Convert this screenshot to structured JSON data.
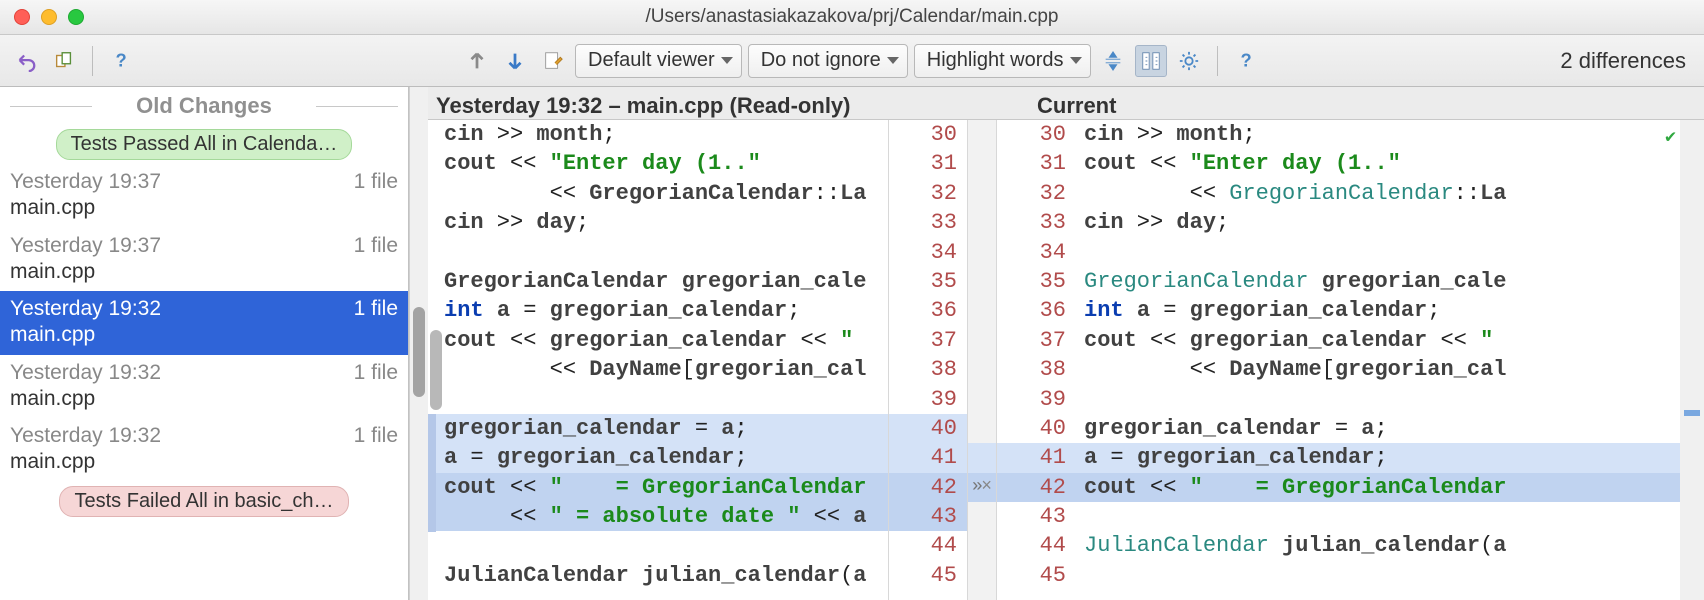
{
  "window": {
    "title": "/Users/anastasiakazakova/prj/Calendar/main.cpp"
  },
  "toolbar": {
    "viewer": "Default viewer",
    "ignore": "Do not ignore",
    "highlight": "Highlight words",
    "diff_count": "2 differences"
  },
  "sidebar": {
    "section": "Old Changes",
    "pill_pass": "Tests Passed All in Calenda…",
    "pill_fail": "Tests Failed All in basic_ch…",
    "items": [
      {
        "ts": "Yesterday 19:37",
        "fc": "1 file",
        "fn": "main.cpp"
      },
      {
        "ts": "Yesterday 19:37",
        "fc": "1 file",
        "fn": "main.cpp"
      },
      {
        "ts": "Yesterday 19:32",
        "fc": "1 file",
        "fn": "main.cpp"
      },
      {
        "ts": "Yesterday 19:32",
        "fc": "1 file",
        "fn": "main.cpp"
      },
      {
        "ts": "Yesterday 19:32",
        "fc": "1 file",
        "fn": "main.cpp"
      }
    ]
  },
  "diff": {
    "left_header": "Yesterday 19:32 – main.cpp (Read-only)",
    "right_header": "Current",
    "line_start": 30,
    "left_lines": [
      [
        [
          "id",
          "cin"
        ],
        [
          "plain",
          " >> "
        ],
        [
          "id",
          "month"
        ],
        [
          "plain",
          ";"
        ]
      ],
      [
        [
          "id",
          "cout"
        ],
        [
          "plain",
          " << "
        ],
        [
          "str",
          "\"Enter day (1..\""
        ]
      ],
      [
        [
          "plain",
          "        << "
        ],
        [
          "id",
          "GregorianCalendar"
        ],
        [
          "plain",
          "::"
        ],
        [
          "id",
          "La"
        ]
      ],
      [
        [
          "id",
          "cin"
        ],
        [
          "plain",
          " >> "
        ],
        [
          "id",
          "day"
        ],
        [
          "plain",
          ";"
        ]
      ],
      [],
      [
        [
          "id",
          "GregorianCalendar"
        ],
        [
          "plain",
          " "
        ],
        [
          "id",
          "gregorian_cale"
        ]
      ],
      [
        [
          "kw",
          "int"
        ],
        [
          "plain",
          " "
        ],
        [
          "id",
          "a"
        ],
        [
          "plain",
          " = "
        ],
        [
          "id",
          "gregorian_calendar"
        ],
        [
          "plain",
          ";"
        ]
      ],
      [
        [
          "id",
          "cout"
        ],
        [
          "plain",
          " << "
        ],
        [
          "id",
          "gregorian_calendar"
        ],
        [
          "plain",
          " << "
        ],
        [
          "str",
          "\" "
        ]
      ],
      [
        [
          "plain",
          "        << "
        ],
        [
          "id",
          "DayName"
        ],
        [
          "plain",
          "["
        ],
        [
          "id",
          "gregorian_cal"
        ]
      ],
      [],
      [
        [
          "id",
          "gregorian_calendar"
        ],
        [
          "plain",
          " = "
        ],
        [
          "id",
          "a"
        ],
        [
          "plain",
          ";"
        ]
      ],
      [
        [
          "id",
          "a"
        ],
        [
          "plain",
          " = "
        ],
        [
          "id",
          "gregorian_calendar"
        ],
        [
          "plain",
          ";"
        ]
      ],
      [
        [
          "id",
          "cout"
        ],
        [
          "plain",
          " << "
        ],
        [
          "str",
          "\"    = GregorianCalendar"
        ]
      ],
      [
        [
          "plain",
          "     << "
        ],
        [
          "str",
          "\" = absolute date \""
        ],
        [
          "plain",
          " << "
        ],
        [
          "id",
          "a"
        ]
      ],
      [],
      [
        [
          "id",
          "JulianCalendar"
        ],
        [
          "plain",
          " "
        ],
        [
          "id",
          "julian_calendar"
        ],
        [
          "plain",
          "("
        ],
        [
          "id",
          "a"
        ]
      ]
    ],
    "right_lines": [
      [
        [
          "id",
          "cin"
        ],
        [
          "plain",
          " >> "
        ],
        [
          "id",
          "month"
        ],
        [
          "plain",
          ";"
        ]
      ],
      [
        [
          "id",
          "cout"
        ],
        [
          "plain",
          " << "
        ],
        [
          "str",
          "\"Enter day (1..\""
        ]
      ],
      [
        [
          "plain",
          "        << "
        ],
        [
          "type",
          "GregorianCalendar"
        ],
        [
          "plain",
          "::"
        ],
        [
          "id",
          "La"
        ]
      ],
      [
        [
          "id",
          "cin"
        ],
        [
          "plain",
          " >> "
        ],
        [
          "id",
          "day"
        ],
        [
          "plain",
          ";"
        ]
      ],
      [],
      [
        [
          "type",
          "GregorianCalendar"
        ],
        [
          "plain",
          " "
        ],
        [
          "id",
          "gregorian_cale"
        ]
      ],
      [
        [
          "kw",
          "int"
        ],
        [
          "plain",
          " "
        ],
        [
          "id",
          "a"
        ],
        [
          "plain",
          " = "
        ],
        [
          "id",
          "gregorian_calendar"
        ],
        [
          "plain",
          ";"
        ]
      ],
      [
        [
          "id",
          "cout"
        ],
        [
          "plain",
          " << "
        ],
        [
          "id",
          "gregorian_calendar"
        ],
        [
          "plain",
          " << "
        ],
        [
          "str",
          "\" "
        ]
      ],
      [
        [
          "plain",
          "        << "
        ],
        [
          "id",
          "DayName"
        ],
        [
          "plain",
          "["
        ],
        [
          "id",
          "gregorian_cal"
        ]
      ],
      [],
      [
        [
          "id",
          "gregorian_calendar"
        ],
        [
          "plain",
          " = "
        ],
        [
          "id",
          "a"
        ],
        [
          "plain",
          ";"
        ]
      ],
      [
        [
          "id",
          "a"
        ],
        [
          "plain",
          " = "
        ],
        [
          "id",
          "gregorian_calendar"
        ],
        [
          "plain",
          ";"
        ]
      ],
      [
        [
          "id",
          "cout"
        ],
        [
          "plain",
          " << "
        ],
        [
          "str",
          "\"    = GregorianCalendar"
        ]
      ],
      [],
      [
        [
          "type",
          "JulianCalendar"
        ],
        [
          "plain",
          " "
        ],
        [
          "id",
          "julian_calendar"
        ],
        [
          "plain",
          "("
        ],
        [
          "id",
          "a"
        ]
      ],
      []
    ],
    "left_hl": {
      "10": "blue",
      "11": "blue",
      "12": "blue-strong",
      "13": "blue-strong"
    },
    "right_hl": {
      "11": "blue",
      "12": "blue-strong"
    }
  }
}
